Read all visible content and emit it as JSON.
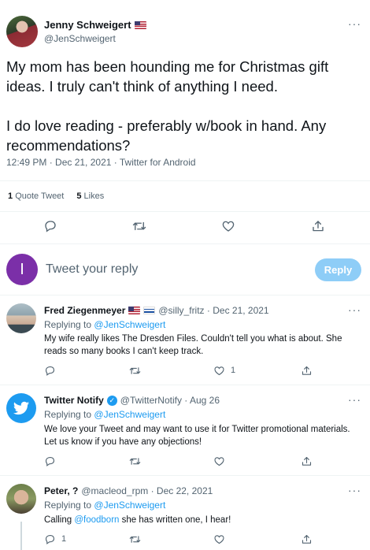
{
  "main_tweet": {
    "author_name": "Jenny Schweigert",
    "author_handle": "@JenSchweigert",
    "text": "My mom has been hounding me for Christmas gift ideas. I truly can't think of anything I need.\n\nI do love reading - preferably w/book in hand. Any recommendations?",
    "meta": "12:49 PM · Dec 21, 2021 · Twitter for Android",
    "quote_count": "1",
    "quote_label": "Quote Tweet",
    "like_count": "5",
    "like_label": "Likes"
  },
  "composer": {
    "avatar_letter": "I",
    "placeholder": "Tweet your reply",
    "reply_label": "Reply"
  },
  "replies": [
    {
      "name": "Fred Ziegenmeyer",
      "handle_date": "@silly_fritz · Dec 21, 2021",
      "replying_to_prefix": "Replying to",
      "replying_to": "@JenSchweigert",
      "text": "My wife really likes The Dresden Files. Couldn't tell you what is about. She reads so many books I can't keep track.",
      "like_count": "1"
    },
    {
      "name": "Twitter Notify",
      "handle_date": "@TwitterNotify · Aug 26",
      "verified_mark": "✓",
      "replying_to_prefix": "Replying to",
      "replying_to": "@JenSchweigert",
      "text": "We love your Tweet and may want to use it for Twitter promotional materials. Let us know if you have any objections!"
    },
    {
      "name": "Peter, ?",
      "handle_date": "@macleod_rpm · Dec 22, 2021",
      "replying_to_prefix": "Replying to",
      "replying_to": "@JenSchweigert",
      "text_prefix": "Calling ",
      "text_mention": "@foodborn",
      "text_suffix": " she has written one, I hear!",
      "reply_count": "1"
    }
  ],
  "more_label": "···",
  "icons": [
    "reply-icon",
    "retweet-icon",
    "like-icon",
    "share-icon",
    "twitter-bird-icon",
    "verified-icon"
  ],
  "colors": {
    "accent": "#1d9bf0",
    "reply_button": "#8ecdf7",
    "muted": "#536471",
    "composer_avatar": "#7b2fa8"
  }
}
